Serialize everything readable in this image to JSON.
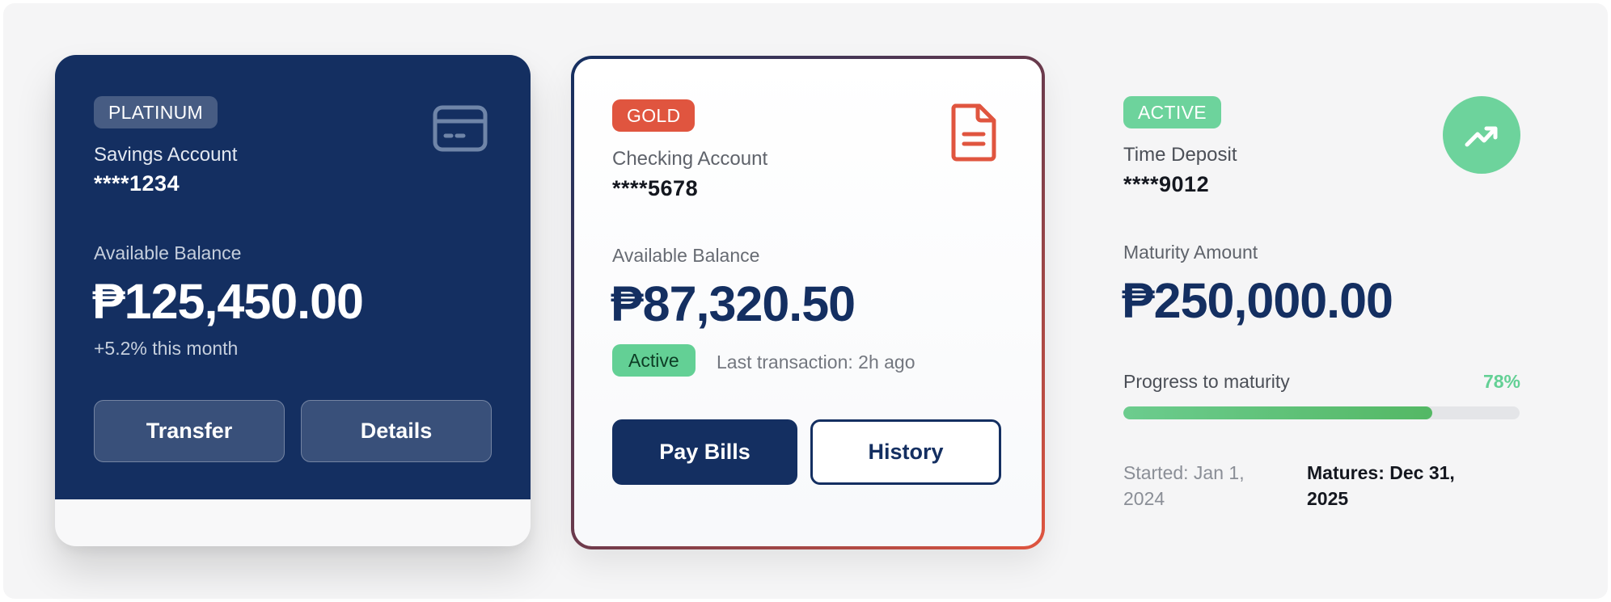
{
  "cards": [
    {
      "tier": "PLATINUM",
      "account_type": "Savings Account",
      "account_number": "****1234",
      "balance_label": "Available Balance",
      "balance": "₱125,450.00",
      "growth": "+5.2% this month",
      "icon": "credit-card-icon",
      "buttons": [
        "Transfer",
        "Details"
      ]
    },
    {
      "tier": "GOLD",
      "account_type": "Checking Account",
      "account_number": "****5678",
      "balance_label": "Available Balance",
      "balance": "₱87,320.50",
      "status": "Active",
      "last_transaction": "Last transaction: 2h ago",
      "icon": "document-icon",
      "buttons": [
        "Pay Bills",
        "History"
      ]
    },
    {
      "tier": "ACTIVE",
      "account_type": "Time Deposit",
      "account_number": "****9012",
      "balance_label": "Maturity Amount",
      "balance": "₱250,000.00",
      "progress_label": "Progress to maturity",
      "progress_text": "78%",
      "progress_value": 0.78,
      "started": "Started: Jan 1, 2024",
      "matures": "Matures: Dec 31, 2025",
      "icon": "trending-up-icon"
    }
  ],
  "colors": {
    "navy": "#142f61",
    "gold": "#e0553f",
    "green": "#6dd39c",
    "background": "#f5f5f6"
  }
}
